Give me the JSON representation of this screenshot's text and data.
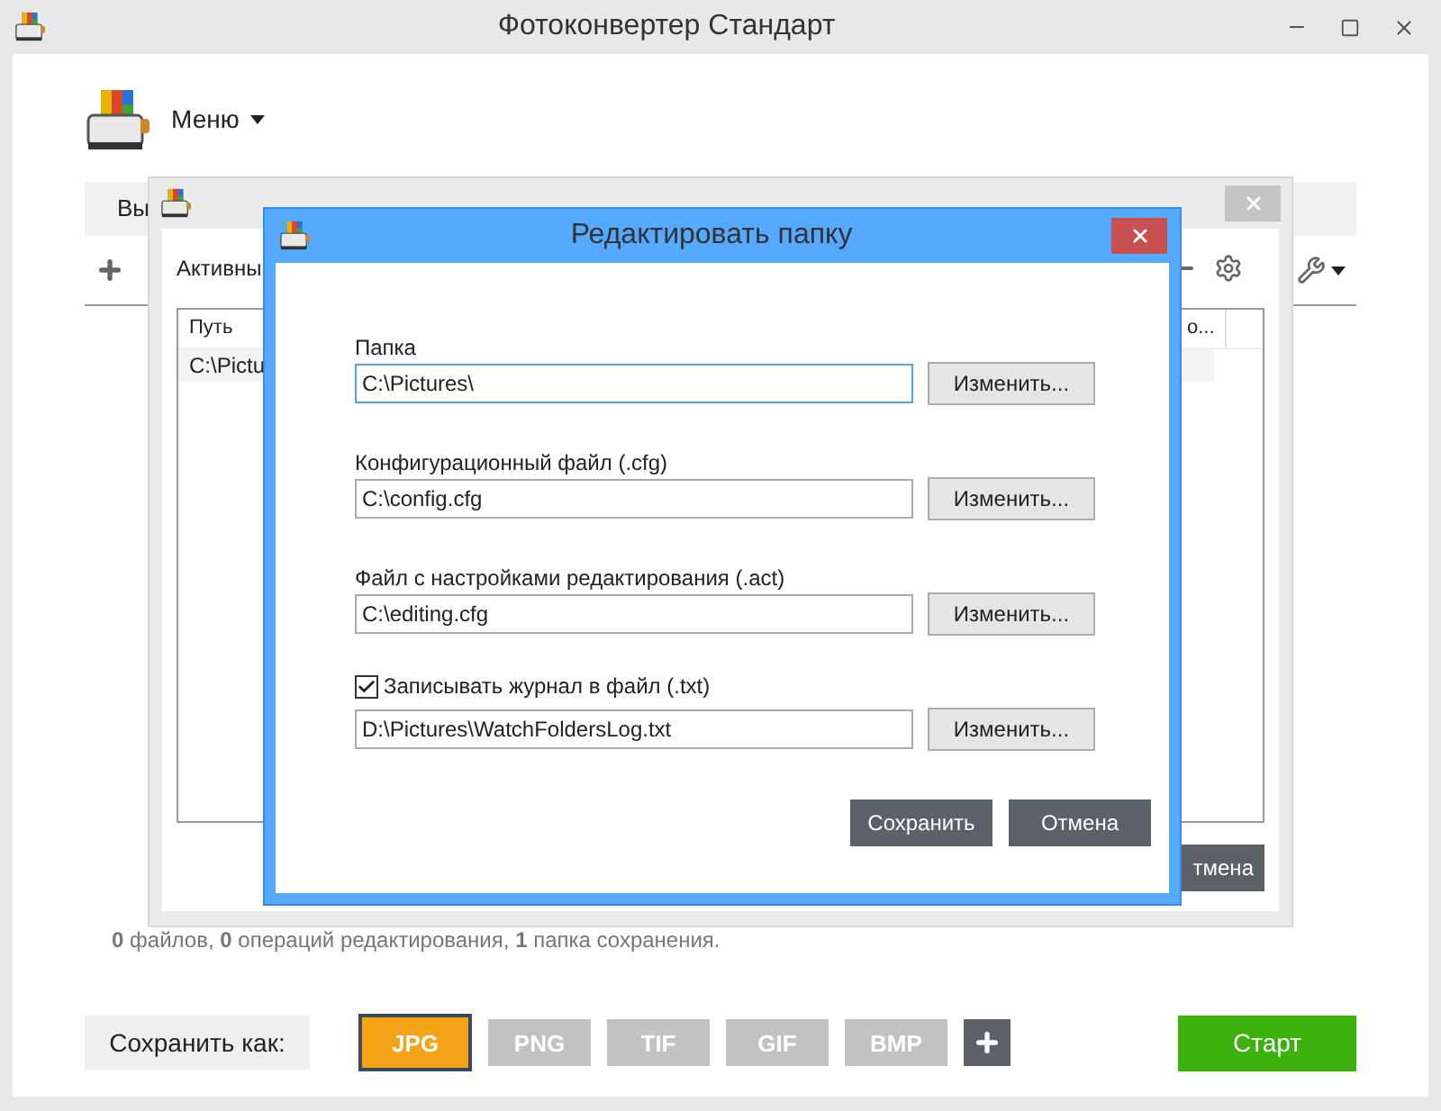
{
  "main_window": {
    "title": "Фотоконвертер Стандарт",
    "menu": "Меню",
    "tab_label": "Вы",
    "status": "**0** файлов, **0** операций редактирования, **1** папка сохранения.",
    "save_as_label": "Сохранить как:",
    "formats": [
      {
        "label": "JPG",
        "selected": true
      },
      {
        "label": "PNG",
        "selected": false
      },
      {
        "label": "TIF",
        "selected": false
      },
      {
        "label": "GIF",
        "selected": false
      },
      {
        "label": "BMP",
        "selected": false
      }
    ],
    "start_button": "Старт"
  },
  "settings_window": {
    "section_label": "Активны",
    "table": {
      "columns": [
        "Путь",
        "о..."
      ],
      "rows": [
        [
          "C:\\Pictu"
        ]
      ]
    },
    "cancel_button": "тмена"
  },
  "dialog": {
    "title": "Редактировать папку",
    "fields": [
      {
        "kind": "text",
        "label": "Папка",
        "value": "C:\\Pictures\\",
        "button": "Изменить...",
        "focused": true
      },
      {
        "kind": "text",
        "label": "Конфигурационный файл (.cfg)",
        "value": "C:\\config.cfg",
        "button": "Изменить...",
        "focused": false
      },
      {
        "kind": "text",
        "label": "Файл с настройками редактирования (.act)",
        "value": "C:\\editing.cfg",
        "button": "Изменить...",
        "focused": false
      },
      {
        "kind": "checkbox",
        "label": "Записывать журнал в файл (.txt)",
        "checked": true,
        "value": "D:\\Pictures\\WatchFoldersLog.txt",
        "button": "Изменить...",
        "focused": false
      }
    ],
    "buttons": [
      "Сохранить",
      "Отмена"
    ]
  }
}
